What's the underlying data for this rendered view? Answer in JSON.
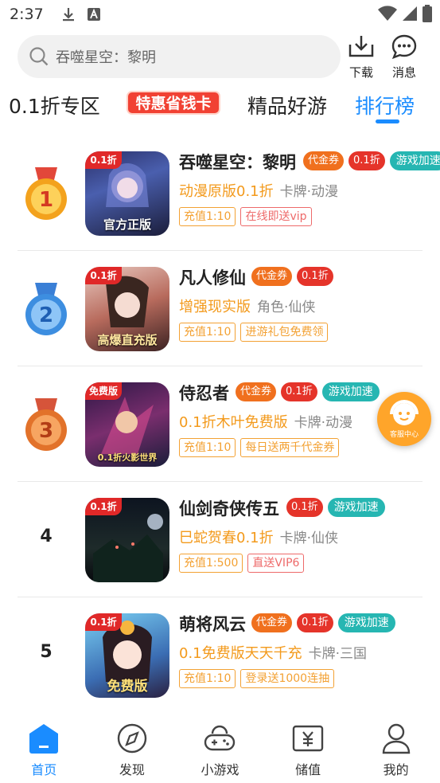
{
  "status_bar": {
    "time": "2:37"
  },
  "search": {
    "placeholder": "吞噬星空：黎明"
  },
  "top_actions": {
    "download_label": "下载",
    "messages_label": "消息"
  },
  "tabs": [
    {
      "label": "0.1折专区",
      "active": false
    },
    {
      "label": "特惠省钱卡",
      "active": false
    },
    {
      "label": "精品好游",
      "active": false
    },
    {
      "label": "排行榜",
      "active": true
    }
  ],
  "games": [
    {
      "rank": "1",
      "name": "吞噬星空：黎明",
      "badges": [
        "代金券",
        "0.1折",
        "游戏加速"
      ],
      "promo": "动漫原版0.1折",
      "genre": "卡牌·动漫",
      "tags": [
        "充值1:10",
        "在线即送vip"
      ],
      "icon_tag": "0.1折",
      "icon_caption": "官方正版",
      "medal_color": "#f3a21d"
    },
    {
      "rank": "2",
      "name": "凡人修仙",
      "badges": [
        "代金券",
        "0.1折"
      ],
      "promo": "增强现实版",
      "genre": "角色·仙侠",
      "tags": [
        "充值1:10",
        "进游礼包免费领"
      ],
      "icon_tag": "0.1折",
      "icon_caption": "高爆直充版",
      "medal_color": "#3d8ee0"
    },
    {
      "rank": "3",
      "name": "侍忍者",
      "badges": [
        "代金券",
        "0.1折",
        "游戏加速"
      ],
      "promo": "0.1折木叶免费版",
      "genre": "卡牌·动漫",
      "tags": [
        "充值1:10",
        "每日送两千代金券"
      ],
      "icon_tag": "免费版",
      "icon_caption": "0.1折火影世界",
      "medal_color": "#e2722a"
    },
    {
      "rank": "4",
      "name": "仙剑奇侠传五",
      "badges": [
        "0.1折",
        "游戏加速"
      ],
      "promo": "巳蛇贺春0.1折",
      "genre": "卡牌·仙侠",
      "tags": [
        "充值1:500",
        "直送VIP6"
      ],
      "icon_tag": "0.1折",
      "icon_caption": ""
    },
    {
      "rank": "5",
      "name": "萌将风云",
      "badges": [
        "代金券",
        "0.1折",
        "游戏加速"
      ],
      "promo": "0.1免费版天天千充",
      "genre": "卡牌·三国",
      "tags": [
        "充值1:10",
        "登录送1000连抽"
      ],
      "icon_tag": "0.1折",
      "icon_caption": "免费版"
    }
  ],
  "float_service": {
    "label": "客服中心"
  },
  "bottom_nav": [
    {
      "label": "首页",
      "icon": "home-icon",
      "active": true
    },
    {
      "label": "发现",
      "icon": "compass-icon",
      "active": false
    },
    {
      "label": "小游戏",
      "icon": "gamepad-icon",
      "active": false
    },
    {
      "label": "储值",
      "icon": "wallet-icon",
      "active": false
    },
    {
      "label": "我的",
      "icon": "profile-icon",
      "active": false
    }
  ],
  "colors": {
    "accent": "#1a8cff",
    "promo": "#f39a1c",
    "speed_badge": "#26b6b2",
    "discount_badge": "#e5342a",
    "voucher_badge": "#f0701e"
  }
}
